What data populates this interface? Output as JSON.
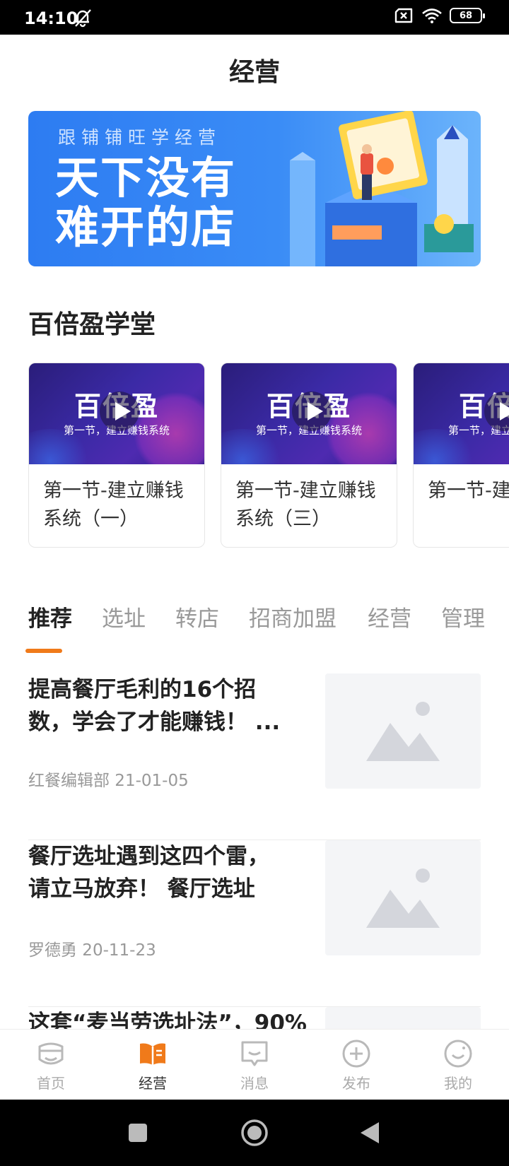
{
  "status_bar": {
    "time": "14:10",
    "battery": "68"
  },
  "header": {
    "title": "经营"
  },
  "banner": {
    "subtitle": "跟铺铺旺学经营",
    "headline_line1": "天下没有",
    "headline_line2": "难开的店"
  },
  "section": {
    "title": "百倍盈学堂"
  },
  "courses": [
    {
      "brand": "百倍盈",
      "subtitle": "第一节，建立赚钱系统",
      "title": "第一节-建立赚钱系统（一）"
    },
    {
      "brand": "百倍盈",
      "subtitle": "第一节，建立赚钱系统",
      "title": "第一节-建立赚钱系统（三）"
    },
    {
      "brand": "百倍盈",
      "subtitle": "第一节，建立赚钱系统",
      "title": "第一节-建立赚钱系统（四"
    }
  ],
  "tabs": [
    {
      "label": "推荐",
      "active": true
    },
    {
      "label": "选址"
    },
    {
      "label": "转店"
    },
    {
      "label": "招商加盟"
    },
    {
      "label": "经营"
    },
    {
      "label": "管理"
    }
  ],
  "articles": [
    {
      "title": "提高餐厅毛利的16个招数，学会了才能赚钱！ ...",
      "meta": "红餐编辑部 21-01-05"
    },
    {
      "title": "餐厅选址遇到这四个雷，请立马放弃！ 餐厅选址",
      "meta": "罗德勇 20-11-23"
    },
    {
      "title": "这套“麦当劳选址法”，90%",
      "meta": ""
    }
  ],
  "bottom_nav": [
    {
      "label": "首页",
      "icon": "home-face-icon"
    },
    {
      "label": "经营",
      "icon": "open-book-icon",
      "active": true
    },
    {
      "label": "消息",
      "icon": "message-icon"
    },
    {
      "label": "发布",
      "icon": "plus-circle-icon"
    },
    {
      "label": "我的",
      "icon": "smile-icon"
    }
  ],
  "colors": {
    "accent": "#f07a1a",
    "banner_blue": "#2d7cf2",
    "course_purple": "#3b2aa6"
  }
}
